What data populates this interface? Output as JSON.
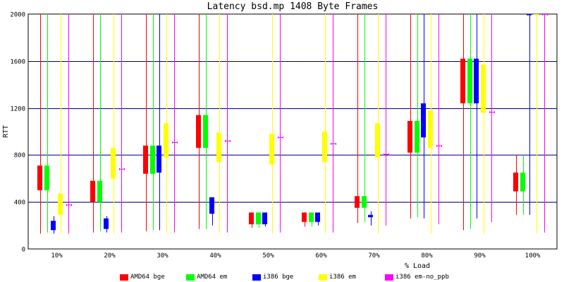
{
  "chart_data": {
    "type": "boxplot",
    "title": "Latency bsd.mp 1408 Byte Frames",
    "xlabel": "% Load",
    "ylabel": "RTT",
    "categories": [
      "10%",
      "20%",
      "30%",
      "40%",
      "50%",
      "60%",
      "70%",
      "80%",
      "90%",
      "100%"
    ],
    "ylim": [
      0,
      2000
    ],
    "yticks": [
      0,
      400,
      800,
      1200,
      1600,
      2000
    ],
    "grid": true,
    "legend_position": "bottom",
    "series": [
      {
        "name": "AMD64 bge",
        "color": "#ff0000",
        "stats": [
          {
            "low": 130,
            "q1": 500,
            "q3": 710,
            "high": 2000
          },
          {
            "low": 140,
            "q1": 400,
            "q3": 580,
            "high": 2000
          },
          {
            "low": 150,
            "q1": 640,
            "q3": 880,
            "high": 2000
          },
          {
            "low": 170,
            "q1": 860,
            "q3": 1140,
            "high": 2000
          },
          {
            "low": 180,
            "q1": 210,
            "q3": 310,
            "high": 310
          },
          {
            "low": 190,
            "q1": 230,
            "q3": 310,
            "high": 310
          },
          {
            "low": 220,
            "q1": 350,
            "q3": 450,
            "high": 2000
          },
          {
            "low": 260,
            "q1": 820,
            "q3": 1090,
            "high": 2000
          },
          {
            "low": 160,
            "q1": 1240,
            "q3": 1620,
            "high": 2000
          },
          {
            "low": 290,
            "q1": 490,
            "q3": 650,
            "high": 800
          }
        ]
      },
      {
        "name": "AMD64 em",
        "color": "#00ff00",
        "stats": [
          {
            "low": 140,
            "q1": 500,
            "q3": 710,
            "high": 2000
          },
          {
            "low": 150,
            "q1": 400,
            "q3": 580,
            "high": 2000
          },
          {
            "low": 160,
            "q1": 640,
            "q3": 880,
            "high": 2000
          },
          {
            "low": 170,
            "q1": 860,
            "q3": 1140,
            "high": 2000
          },
          {
            "low": 180,
            "q1": 210,
            "q3": 310,
            "high": 310
          },
          {
            "low": 190,
            "q1": 230,
            "q3": 310,
            "high": 310
          },
          {
            "low": 230,
            "q1": 350,
            "q3": 450,
            "high": 2000
          },
          {
            "low": 270,
            "q1": 820,
            "q3": 1090,
            "high": 2000
          },
          {
            "low": 170,
            "q1": 1240,
            "q3": 1620,
            "high": 2000
          },
          {
            "low": 290,
            "q1": 490,
            "q3": 650,
            "high": 800
          }
        ]
      },
      {
        "name": "i386 bge",
        "color": "#0000ff",
        "stats": [
          {
            "low": 130,
            "q1": 160,
            "q3": 240,
            "high": 280
          },
          {
            "low": 140,
            "q1": 170,
            "q3": 260,
            "high": 280
          },
          {
            "low": 160,
            "q1": 650,
            "q3": 880,
            "high": 2000
          },
          {
            "low": 200,
            "q1": 300,
            "q3": 440,
            "high": 440
          },
          {
            "low": 190,
            "q1": 210,
            "q3": 310,
            "high": 310
          },
          {
            "low": 200,
            "q1": 230,
            "q3": 310,
            "high": 310
          },
          {
            "low": 200,
            "q1": 270,
            "q3": 290,
            "high": 320
          },
          {
            "low": 260,
            "q1": 950,
            "q3": 1240,
            "high": 2000
          },
          {
            "low": 260,
            "q1": 1240,
            "q3": 1620,
            "high": 2000
          },
          {
            "low": 290,
            "q1": 1990,
            "q3": 2000,
            "high": 2000
          }
        ]
      },
      {
        "name": "i386 em",
        "color": "#ffff00",
        "stats": [
          {
            "low": 130,
            "q1": 290,
            "q3": 470,
            "high": 2000
          },
          {
            "low": 130,
            "q1": 600,
            "q3": 860,
            "high": 2000
          },
          {
            "low": 130,
            "q1": 780,
            "q3": 1070,
            "high": 2000
          },
          {
            "low": 130,
            "q1": 740,
            "q3": 990,
            "high": 2000
          },
          {
            "low": 130,
            "q1": 720,
            "q3": 980,
            "high": 2000
          },
          {
            "low": 130,
            "q1": 740,
            "q3": 1000,
            "high": 2000
          },
          {
            "low": 130,
            "q1": 780,
            "q3": 1070,
            "high": 2000
          },
          {
            "low": 130,
            "q1": 860,
            "q3": 1180,
            "high": 2000
          },
          {
            "low": 130,
            "q1": 1160,
            "q3": 1570,
            "high": 2000
          },
          {
            "low": 130,
            "q1": 1990,
            "q3": 2000,
            "high": 2000
          }
        ]
      },
      {
        "name": "i386 em-no_ppb",
        "color": "#ff00ff",
        "stats": [
          {
            "low": 130,
            "q1": 380,
            "q3": 380,
            "high": 2000
          },
          {
            "low": 140,
            "q1": 680,
            "q3": 680,
            "high": 2000
          },
          {
            "low": 140,
            "q1": 910,
            "q3": 910,
            "high": 2000
          },
          {
            "low": 140,
            "q1": 920,
            "q3": 920,
            "high": 2000
          },
          {
            "low": 140,
            "q1": 950,
            "q3": 950,
            "high": 2000
          },
          {
            "low": 140,
            "q1": 900,
            "q3": 900,
            "high": 2000
          },
          {
            "low": 200,
            "q1": 810,
            "q3": 810,
            "high": 2000
          },
          {
            "low": 210,
            "q1": 880,
            "q3": 880,
            "high": 2000
          },
          {
            "low": 230,
            "q1": 1170,
            "q3": 1170,
            "high": 2000
          },
          {
            "low": 140,
            "q1": 2000,
            "q3": 2000,
            "high": 2000
          }
        ]
      }
    ]
  }
}
